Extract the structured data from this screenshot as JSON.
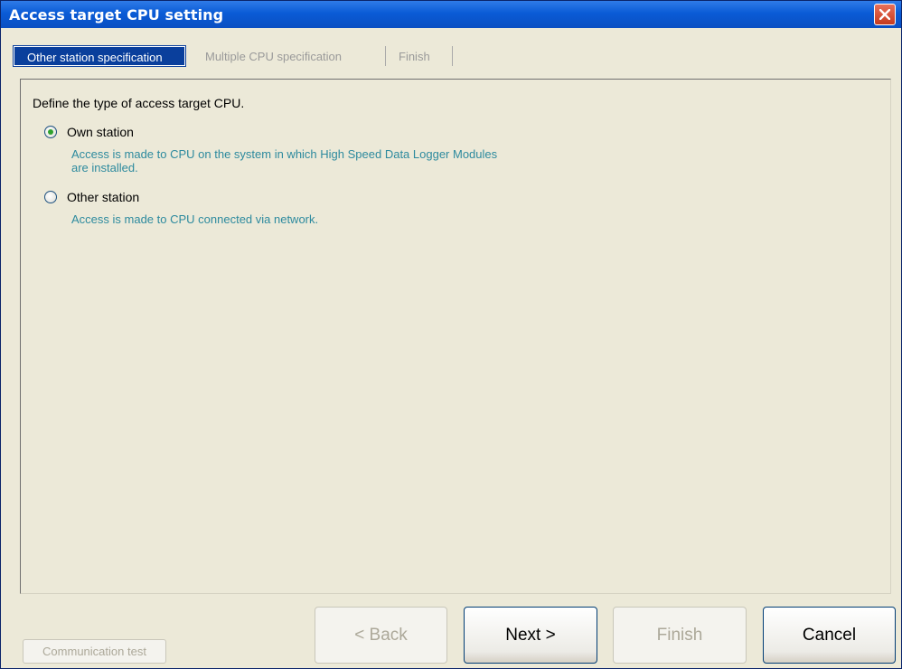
{
  "window": {
    "title": "Access target CPU setting"
  },
  "tabs": [
    {
      "label": "Other station specification",
      "active": true
    },
    {
      "label": "Multiple CPU specification",
      "active": false
    },
    {
      "label": "Finish",
      "active": false
    }
  ],
  "content": {
    "prompt": "Define the type of access target CPU.",
    "options": [
      {
        "label": "Own station",
        "checked": true,
        "desc_line1": "Access is made to CPU on the system in which High Speed Data Logger Modules",
        "desc_line2": "are installed."
      },
      {
        "label": "Other station",
        "checked": false,
        "desc_line1": "Access is made to CPU connected via network."
      }
    ]
  },
  "buttons": {
    "communication_test": "Communication test",
    "back": "< Back",
    "next": "Next >",
    "finish": "Finish",
    "cancel": "Cancel"
  },
  "colors": {
    "titlebar": "#0a5bd6",
    "dialog_bg": "#ece9d8",
    "description_text": "#2d8a9e",
    "active_tab": "#0a3f9c"
  }
}
